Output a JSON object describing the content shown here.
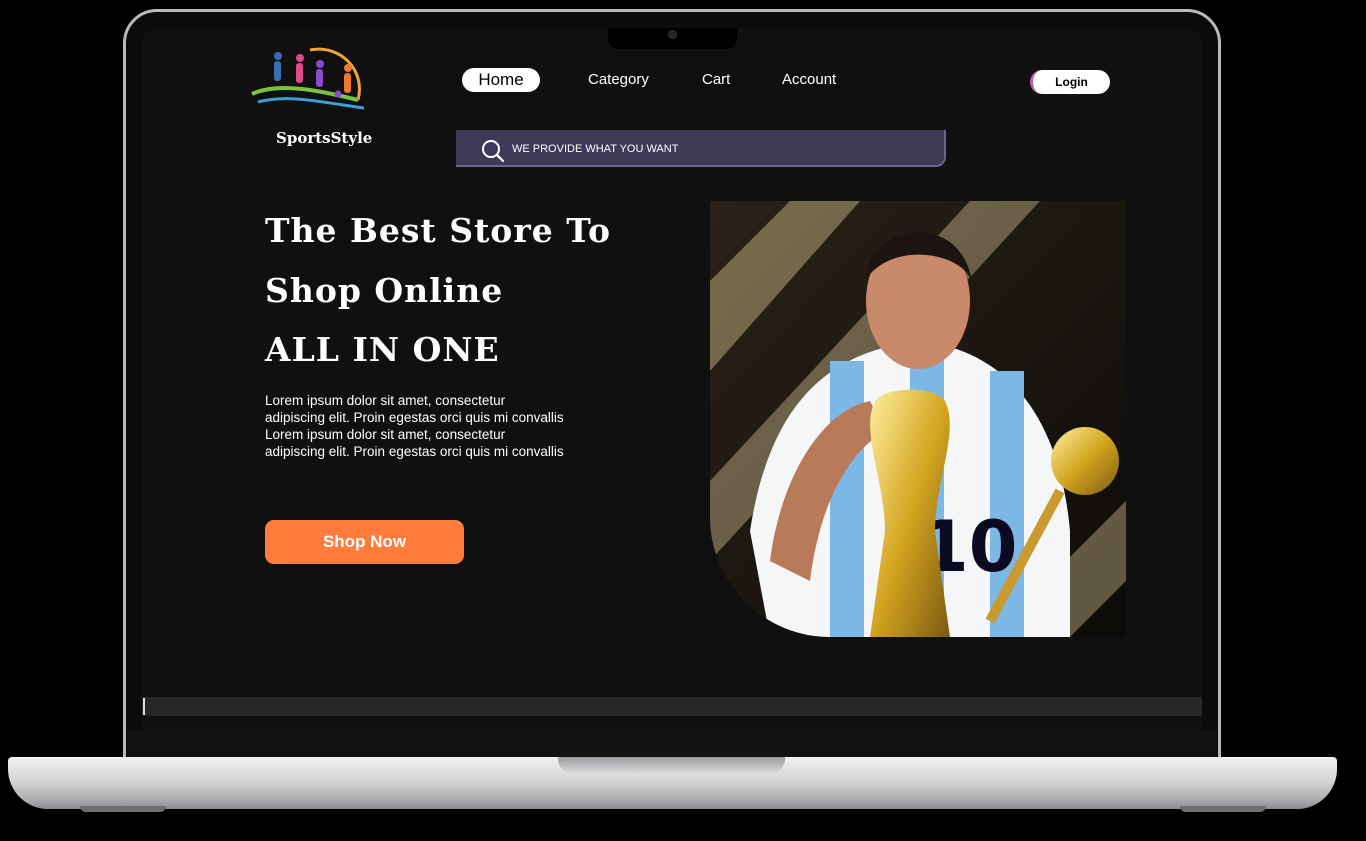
{
  "brand": {
    "name": "SportsStyle",
    "logo_icon": "athletes-logo-icon"
  },
  "nav": {
    "items": [
      {
        "label": "Home",
        "active": true
      },
      {
        "label": "Category"
      },
      {
        "label": "Cart"
      },
      {
        "label": "Account"
      }
    ],
    "login_label": "Login"
  },
  "search": {
    "placeholder": "WE PROVIDE WHAT YOU WANT",
    "icon": "search-icon"
  },
  "hero": {
    "line1": "The Best Store To",
    "line2": "Shop Online",
    "line3": "ALL IN ONE",
    "description": "Lorem ipsum dolor sit amet, consectetur adipiscing elit. Proin egestas orci quis mi convallis Lorem ipsum dolor sit amet, consectetur adipiscing elit. Proin egestas orci quis mi convallis",
    "cta_label": "Shop Now",
    "image_subject": "football player kissing world cup trophy"
  },
  "colors": {
    "background": "#101010",
    "accent": "#ff7c3c",
    "search_bg": "#3d3a58",
    "text": "#ffffff"
  }
}
